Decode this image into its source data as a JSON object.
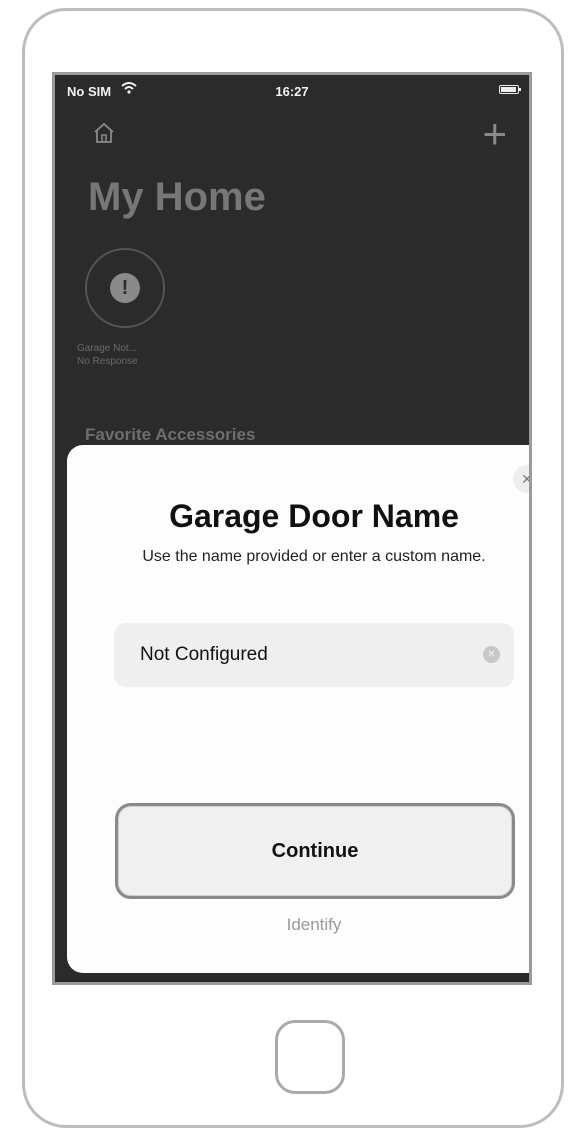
{
  "status_bar": {
    "carrier": "No SIM",
    "time": "16:27"
  },
  "home": {
    "title": "My Home",
    "accessory": {
      "name": "Garage Not...",
      "status": "No Response"
    },
    "section_label": "Favorite Accessories"
  },
  "sheet": {
    "close_glyph": "✕",
    "title": "Garage Door Name",
    "subtitle": "Use the name provided or enter a custom name.",
    "name_field": {
      "value": "Not Configured",
      "placeholder": ""
    },
    "continue_label": "Continue",
    "identify_label": "Identify"
  },
  "colors": {
    "screen_background": "#2b2b2b",
    "sheet_background": "#fdfdfd",
    "accent_gray": "#8a8a8a"
  },
  "icons": [
    "wifi-icon",
    "battery-icon",
    "home-icon",
    "add-icon",
    "alert-icon",
    "close-icon",
    "clear-icon"
  ]
}
